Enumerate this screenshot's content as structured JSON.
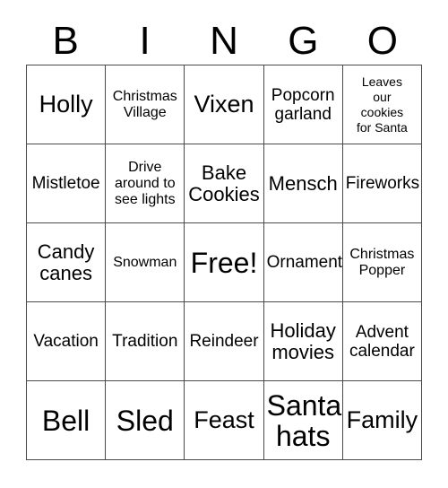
{
  "card": {
    "header_letters": [
      "B",
      "I",
      "N",
      "G",
      "O"
    ],
    "border_color": "#4a4a4a",
    "background_color": "#ffffff",
    "text_color": "#000000",
    "rows": [
      [
        {
          "text": "Holly",
          "size": "lg"
        },
        {
          "text": "Christmas\nVillage",
          "size": "xs"
        },
        {
          "text": "Vixen",
          "size": "lg"
        },
        {
          "text": "Popcorn\ngarland",
          "size": "sm"
        },
        {
          "text": "Leaves\nour\ncookies\nfor Santa",
          "size": "xxs"
        }
      ],
      [
        {
          "text": "Mistletoe",
          "size": "sm"
        },
        {
          "text": "Drive\naround to\nsee lights",
          "size": "xs"
        },
        {
          "text": "Bake\nCookies",
          "size": "md"
        },
        {
          "text": "Mensch",
          "size": "md"
        },
        {
          "text": "Fireworks",
          "size": "sm"
        }
      ],
      [
        {
          "text": "Candy\ncanes",
          "size": "md"
        },
        {
          "text": "Snowman",
          "size": "xs"
        },
        {
          "text": "Free!",
          "size": "xl"
        },
        {
          "text": "Ornament",
          "size": "sm"
        },
        {
          "text": "Christmas\nPopper",
          "size": "xs"
        }
      ],
      [
        {
          "text": "Vacation",
          "size": "sm"
        },
        {
          "text": "Tradition",
          "size": "sm"
        },
        {
          "text": "Reindeer",
          "size": "sm"
        },
        {
          "text": "Holiday\nmovies",
          "size": "md"
        },
        {
          "text": "Advent\ncalendar",
          "size": "sm"
        }
      ],
      [
        {
          "text": "Bell",
          "size": "xl"
        },
        {
          "text": "Sled",
          "size": "xl"
        },
        {
          "text": "Feast",
          "size": "lg"
        },
        {
          "text": "Santa\nhats",
          "size": "xl"
        },
        {
          "text": "Family",
          "size": "lg"
        }
      ]
    ]
  }
}
